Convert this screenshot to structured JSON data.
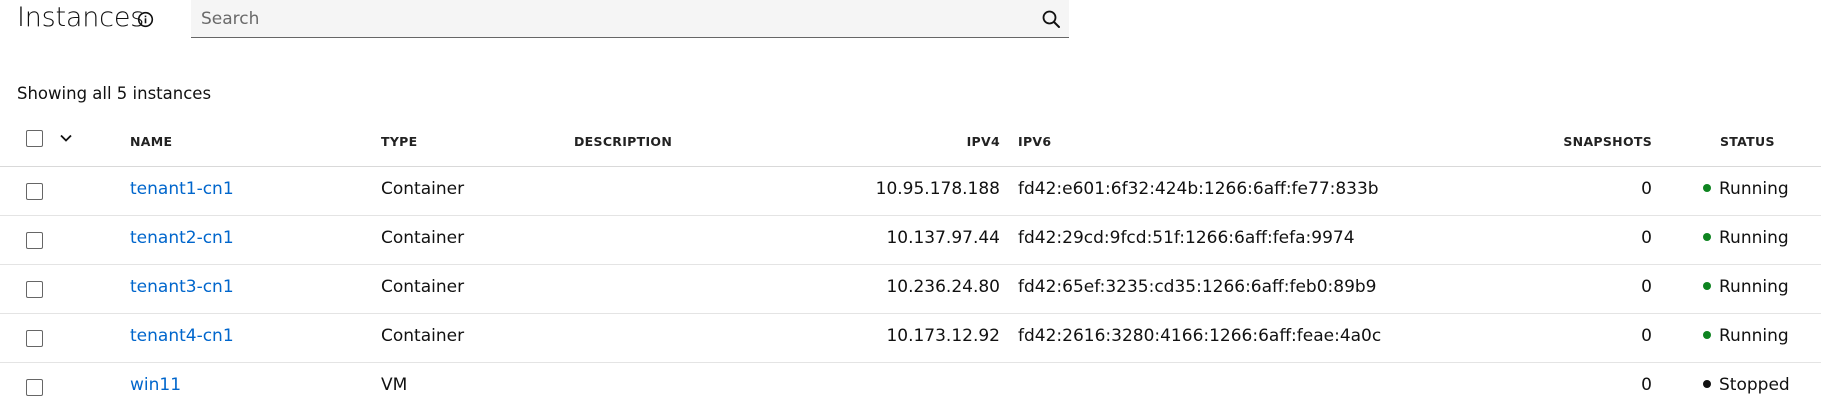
{
  "header": {
    "title": "Instances",
    "info_icon": "info-circle-icon",
    "search": {
      "placeholder": "Search",
      "value": "",
      "icon": "search-icon"
    }
  },
  "summary": {
    "count_text": "Showing all 5 instances"
  },
  "table": {
    "columns": {
      "name": "NAME",
      "type": "TYPE",
      "description": "DESCRIPTION",
      "ipv4": "IPV4",
      "ipv6": "IPV6",
      "snapshots": "SNAPSHOTS",
      "status": "STATUS"
    },
    "rows": [
      {
        "name": "tenant1-cn1",
        "type": "Container",
        "description": "",
        "ipv4": "10.95.178.188",
        "ipv6": "fd42:e601:6f32:424b:1266:6aff:fe77:833b",
        "snapshots": "0",
        "status": "Running",
        "status_color": "#0e8420"
      },
      {
        "name": "tenant2-cn1",
        "type": "Container",
        "description": "",
        "ipv4": "10.137.97.44",
        "ipv6": "fd42:29cd:9fcd:51f:1266:6aff:fefa:9974",
        "snapshots": "0",
        "status": "Running",
        "status_color": "#0e8420"
      },
      {
        "name": "tenant3-cn1",
        "type": "Container",
        "description": "",
        "ipv4": "10.236.24.80",
        "ipv6": "fd42:65ef:3235:cd35:1266:6aff:feb0:89b9",
        "snapshots": "0",
        "status": "Running",
        "status_color": "#0e8420"
      },
      {
        "name": "tenant4-cn1",
        "type": "Container",
        "description": "",
        "ipv4": "10.173.12.92",
        "ipv6": "fd42:2616:3280:4166:1266:6aff:feae:4a0c",
        "snapshots": "0",
        "status": "Running",
        "status_color": "#0e8420"
      },
      {
        "name": "win11",
        "type": "VM",
        "description": "",
        "ipv4": "",
        "ipv6": "",
        "snapshots": "0",
        "status": "Stopped",
        "status_color": "#111111"
      }
    ]
  },
  "colors": {
    "link": "#0066cc",
    "running": "#0e8420",
    "stopped": "#111111"
  }
}
